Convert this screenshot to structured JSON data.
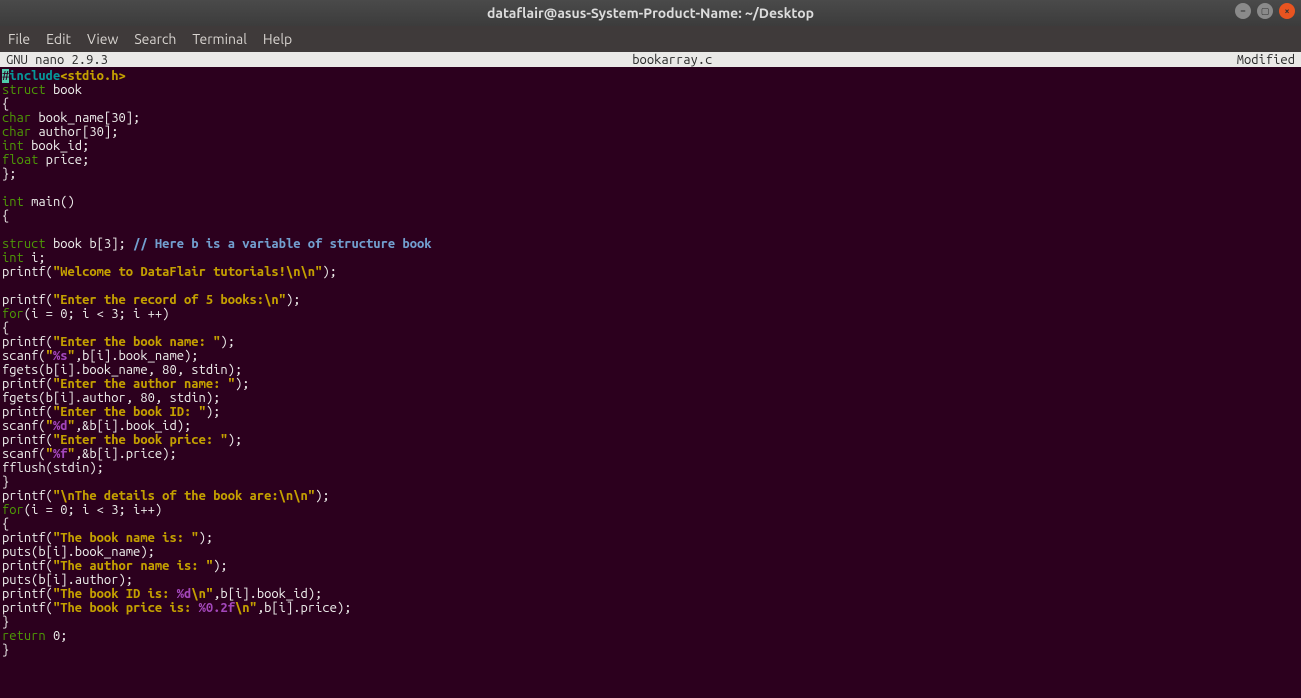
{
  "title": "dataflair@asus-System-Product-Name: ~/Desktop",
  "menu": {
    "file": "File",
    "edit": "Edit",
    "view": "View",
    "search": "Search",
    "terminal": "Terminal",
    "help": "Help"
  },
  "status": {
    "left": "  GNU nano 2.9.3",
    "center": "bookarray.c",
    "right": "Modified  "
  },
  "code": {
    "l1_hash": "#",
    "l1_include": "include",
    "l1_hdr": "<stdio.h>",
    "l2_kw": "struct",
    "l2_rest": " book",
    "l3": "{",
    "l4_kw": "char",
    "l4_rest": " book_name[30];",
    "l5_kw": "char",
    "l5_rest": " author[30];",
    "l6_kw": "int",
    "l6_rest": " book_id;",
    "l7_kw": "float",
    "l7_rest": " price;",
    "l8": "};",
    "l9": "",
    "l10_kw": "int",
    "l10_rest": " main()",
    "l11": "{",
    "l12": "",
    "l13_kw": "struct",
    "l13_mid": " book b[3]; ",
    "l13_cmt": "// Here b is a variable of structure book",
    "l14_kw": "int",
    "l14_rest": " i;",
    "l15_a": "printf(",
    "l15_s": "\"Welcome to DataFlair tutorials!\\n\\n\"",
    "l15_b": ");",
    "l16": "",
    "l17_a": "printf(",
    "l17_s": "\"Enter the record of 5 books:\\n\"",
    "l17_b": ");",
    "l18_kw": "for",
    "l18_rest": "(i = 0; i < 3; i ++)",
    "l19": "{",
    "l20_a": "printf(",
    "l20_s": "\"Enter the book name: \"",
    "l20_b": ");",
    "l21_a": "scanf(",
    "l21_q1": "\"",
    "l21_fmt": "%s",
    "l21_q2": "\"",
    "l21_b": ",b[i].book_name);",
    "l22": "fgets(b[i].book_name, 80, stdin);",
    "l23_a": "printf(",
    "l23_s": "\"Enter the author name: \"",
    "l23_b": ");",
    "l24": "fgets(b[i].author, 80, stdin);",
    "l25_a": "printf(",
    "l25_s": "\"Enter the book ID: \"",
    "l25_b": ");",
    "l26_a": "scanf(",
    "l26_q1": "\"",
    "l26_fmt": "%d",
    "l26_q2": "\"",
    "l26_b": ",&b[i].book_id);",
    "l27_a": "printf(",
    "l27_s": "\"Enter the book price: \"",
    "l27_b": ");",
    "l28_a": "scanf(",
    "l28_q1": "\"",
    "l28_fmt": "%f",
    "l28_q2": "\"",
    "l28_b": ",&b[i].price);",
    "l29": "fflush(stdin);",
    "l30": "}",
    "l31_a": "printf(",
    "l31_s": "\"\\nThe details of the book are:\\n\\n\"",
    "l31_b": ");",
    "l32_kw": "for",
    "l32_rest": "(i = 0; i < 3; i++)",
    "l33": "{",
    "l34_a": "printf(",
    "l34_s": "\"The book name is: \"",
    "l34_b": ");",
    "l35": "puts(b[i].book_name);",
    "l36_a": "printf(",
    "l36_s": "\"The author name is: \"",
    "l36_b": ");",
    "l37": "puts(b[i].author);",
    "l38_a": "printf(",
    "l38_s1": "\"The book ID is: ",
    "l38_fmt": "%d",
    "l38_s2": "\\n\"",
    "l38_b": ",b[i].book_id);",
    "l39_a": "printf(",
    "l39_s1": "\"The book price is: ",
    "l39_fmt": "%0.2f",
    "l39_s2": "\\n\"",
    "l39_b": ",b[i].price);",
    "l40": "}",
    "l41_kw": "return",
    "l41_rest": " 0;",
    "l42": "}"
  }
}
